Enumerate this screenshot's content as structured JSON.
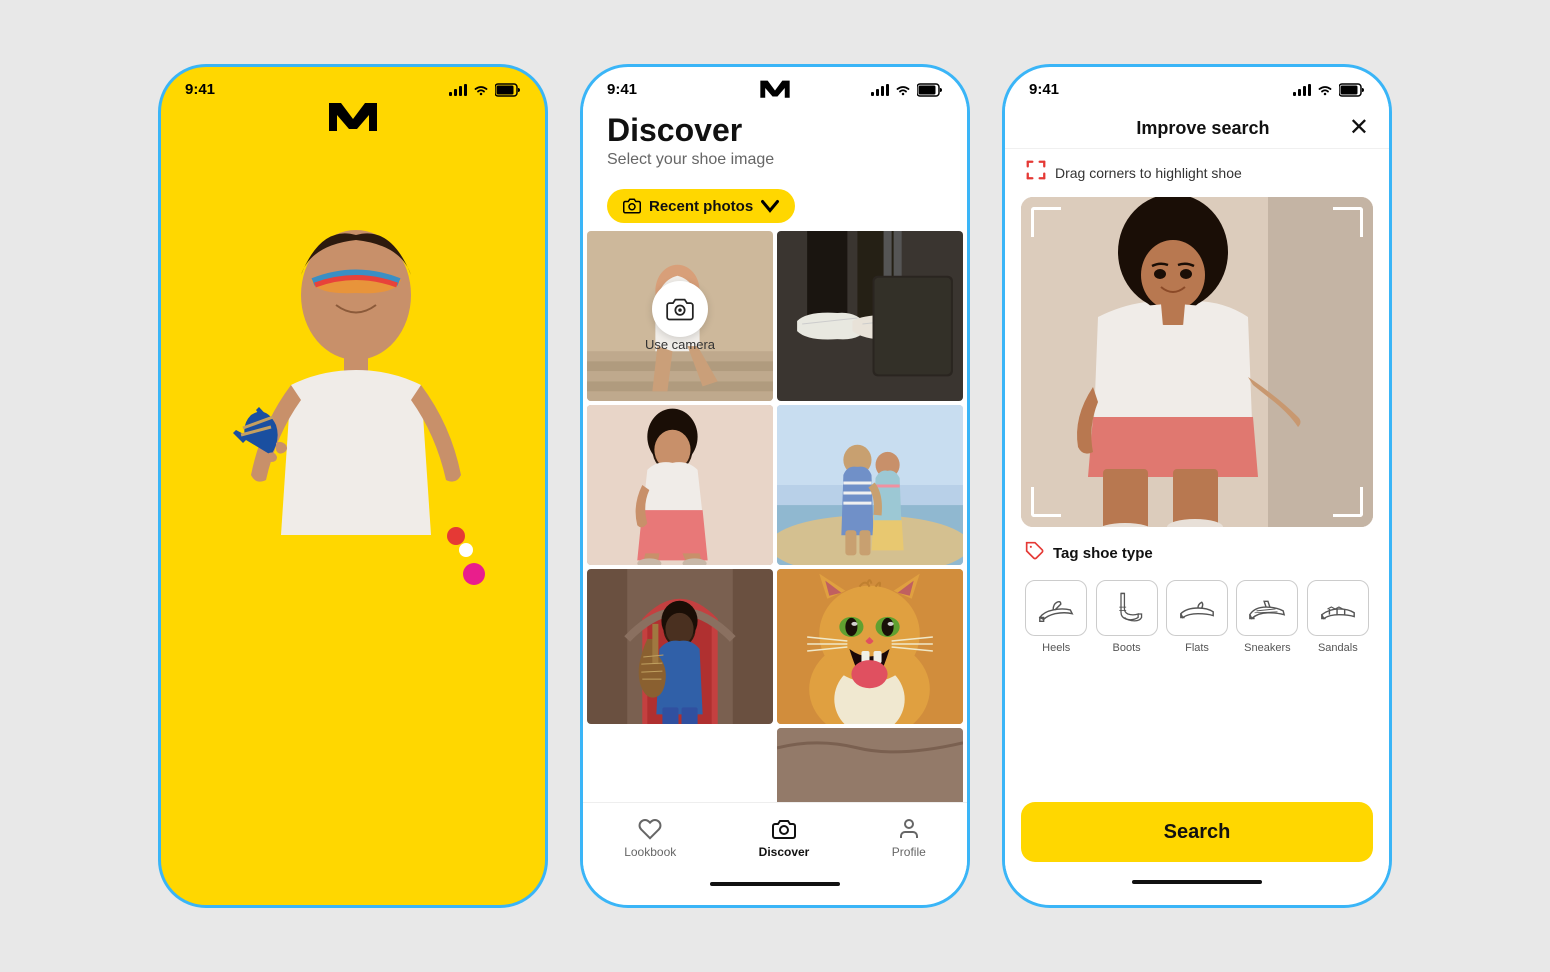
{
  "phone1": {
    "status_time": "9:41",
    "status_icons": "●●● ▲ 🔋",
    "app_logo": "M",
    "dot_colors": [
      "#e53935",
      "#ffffff",
      "#e91e8c"
    ]
  },
  "phone2": {
    "status_time": "9:41",
    "title": "Discover",
    "subtitle": "Select your shoe image",
    "filter_label": "Recent photos",
    "filter_icon": "camera",
    "use_camera": "Use camera",
    "nav": [
      {
        "label": "Lookbook",
        "icon": "heart"
      },
      {
        "label": "Discover",
        "icon": "camera",
        "active": true
      },
      {
        "label": "Profile",
        "icon": "person"
      }
    ],
    "photos": [
      "camera",
      "shoe-close",
      "woman-sitting",
      "couple-beach",
      "musician-door",
      "cat-open-mouth",
      "partial-bottom"
    ]
  },
  "phone3": {
    "status_time": "9:41",
    "header_title": "Improve search",
    "close_label": "×",
    "hint_text": "Drag corners to highlight shoe",
    "tag_section_title": "Tag shoe type",
    "shoe_types": [
      {
        "label": "Heels",
        "icon": "heels"
      },
      {
        "label": "Boots",
        "icon": "boots"
      },
      {
        "label": "Flats",
        "icon": "flats"
      },
      {
        "label": "Sneakers",
        "icon": "sneakers"
      },
      {
        "label": "Sandals",
        "icon": "sandals"
      }
    ],
    "search_button": "Search"
  }
}
